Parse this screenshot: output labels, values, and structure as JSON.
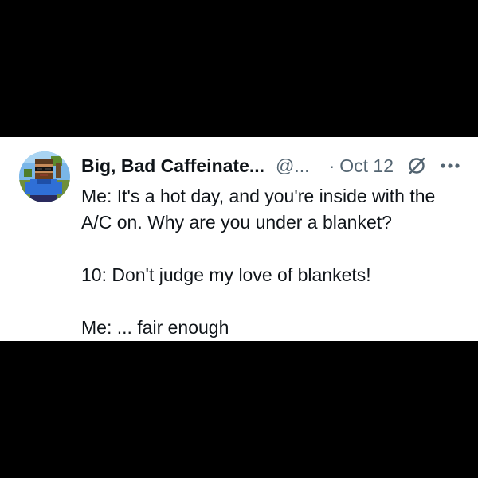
{
  "tweet": {
    "author": {
      "display_name": "Big, Bad Caffeinate...",
      "handle": "@...",
      "avatar_icon": "pixel-art-avatar"
    },
    "separator": "·",
    "timestamp": "Oct 12",
    "grok_icon": "grok-slashed-circle-icon",
    "more_icon": "ellipsis-icon",
    "text_lines": [
      "Me: It's a hot day, and you're inside with the",
      "A/C on. Why are you under a blanket?",
      "10: Don't judge my love of blankets!",
      "Me: ... fair enough"
    ]
  },
  "colors": {
    "background": "#000000",
    "card": "#ffffff",
    "text_primary": "#0f1419",
    "text_secondary": "#536471"
  }
}
